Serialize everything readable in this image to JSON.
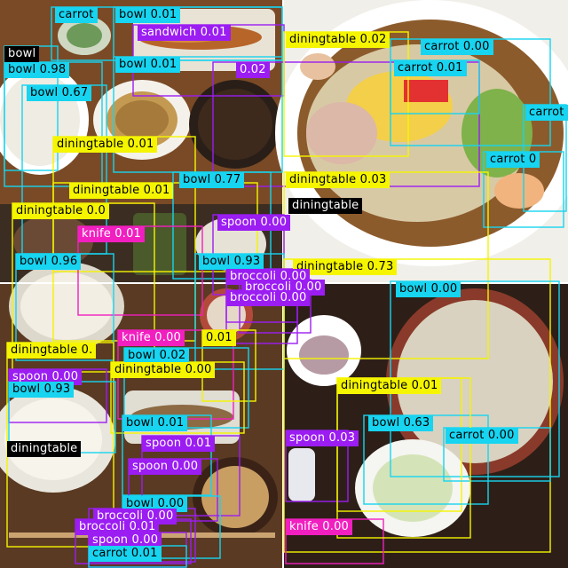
{
  "colors": {
    "bowl": "#17d4f0",
    "diningtable": "#f5f500",
    "carrot": "#17d4f0",
    "spoon": "#9b1df2",
    "knife": "#f21fc0",
    "broccoli": "#9b1df2",
    "sandwich": "#9b1df2",
    "dark_label": "#000000",
    "white_text": "#ffffff",
    "black_text": "#000000"
  },
  "photos": [
    {
      "name": "top-left-photo",
      "desc": "rice, noodles, soup, grilled fish set meal"
    },
    {
      "name": "top-right-photo",
      "desc": "cold ramen with egg, cucumber, shrimp, chicken"
    },
    {
      "name": "bottom-left-photo",
      "desc": "rice, fish, miso soup set meal"
    },
    {
      "name": "bottom-right-photo",
      "desc": "cold noodles with dipping bowl and green onion"
    }
  ],
  "detections": [
    {
      "text": "carrot",
      "cls": "carrot",
      "score": ""
    },
    {
      "text": "bowl 0.01",
      "cls": "bowl",
      "score": "0.01"
    },
    {
      "text": "sandwich 0.01",
      "cls": "sandwich",
      "score": "0.01"
    },
    {
      "text": "bowl",
      "cls": "dark",
      "score": ""
    },
    {
      "text": "bowl 0.98",
      "cls": "bowl",
      "score": "0.98"
    },
    {
      "text": "bowl 0.01",
      "cls": "bowl",
      "score": "0.01"
    },
    {
      "text": "0.02",
      "cls": "sandwich",
      "score": "0.02"
    },
    {
      "text": "bowl 0.67",
      "cls": "bowl",
      "score": "0.67"
    },
    {
      "text": "diningtable 0.01",
      "cls": "diningtable",
      "score": "0.01"
    },
    {
      "text": "diningtable 0.02",
      "cls": "diningtable",
      "score": "0.02"
    },
    {
      "text": "carrot 0.00",
      "cls": "carrot",
      "score": "0.00"
    },
    {
      "text": "carrot 0.01",
      "cls": "carrot",
      "score": "0.01"
    },
    {
      "text": "carrot",
      "cls": "carrot",
      "score": ""
    },
    {
      "text": "carrot 0",
      "cls": "carrot",
      "score": "0"
    },
    {
      "text": "diningtable 0.03",
      "cls": "diningtable",
      "score": "0.03"
    },
    {
      "text": "diningtable",
      "cls": "dark",
      "score": ""
    },
    {
      "text": "diningtable 0.01",
      "cls": "diningtable",
      "score": "0.01"
    },
    {
      "text": "bowl 0.77",
      "cls": "bowl",
      "score": "0.77"
    },
    {
      "text": "diningtable 0.0",
      "cls": "diningtable",
      "score": "0.0"
    },
    {
      "text": "knife 0.01",
      "cls": "knife",
      "score": "0.01"
    },
    {
      "text": "spoon 0.00",
      "cls": "spoon",
      "score": "0.00"
    },
    {
      "text": "bowl 0.96",
      "cls": "bowl",
      "score": "0.96"
    },
    {
      "text": "bowl 0.93",
      "cls": "bowl",
      "score": "0.93"
    },
    {
      "text": "diningtable 0.73",
      "cls": "diningtable",
      "score": "0.73"
    },
    {
      "text": "broccoli 0.00",
      "cls": "broccoli",
      "score": "0.00"
    },
    {
      "text": "broccoli 0.00",
      "cls": "broccoli",
      "score": "0.00"
    },
    {
      "text": "broccoli 0.00",
      "cls": "broccoli",
      "score": "0.00"
    },
    {
      "text": "bowl 0.00",
      "cls": "bowl",
      "score": "0.00"
    },
    {
      "text": "knife 0.00",
      "cls": "knife",
      "score": "0.00"
    },
    {
      "text": "0.01",
      "cls": "diningtable",
      "score": "0.01"
    },
    {
      "text": "diningtable 0.",
      "cls": "diningtable",
      "score": "0."
    },
    {
      "text": "bowl 0.02",
      "cls": "bowl",
      "score": "0.02"
    },
    {
      "text": "diningtable 0.00",
      "cls": "diningtable",
      "score": "0.00"
    },
    {
      "text": "spoon 0.00",
      "cls": "spoon",
      "score": "0.00"
    },
    {
      "text": "bowl 0.93",
      "cls": "bowl",
      "score": "0.93"
    },
    {
      "text": "diningtable 0.01",
      "cls": "diningtable",
      "score": "0.01"
    },
    {
      "text": "bowl 0.01",
      "cls": "bowl",
      "score": "0.01"
    },
    {
      "text": "bowl 0.63",
      "cls": "bowl",
      "score": "0.63"
    },
    {
      "text": "carrot 0.00",
      "cls": "carrot",
      "score": "0.00"
    },
    {
      "text": "spoon 0.03",
      "cls": "spoon",
      "score": "0.03"
    },
    {
      "text": "diningtable",
      "cls": "dark",
      "score": ""
    },
    {
      "text": "spoon 0.01",
      "cls": "spoon",
      "score": "0.01"
    },
    {
      "text": "spoon 0.00",
      "cls": "spoon",
      "score": "0.00"
    },
    {
      "text": "bowl 0.00",
      "cls": "bowl",
      "score": "0.00"
    },
    {
      "text": "broccoli 0.00",
      "cls": "broccoli",
      "score": "0.00"
    },
    {
      "text": "broccoli 0.01",
      "cls": "broccoli",
      "score": "0.01"
    },
    {
      "text": "spoon 0.00",
      "cls": "spoon",
      "score": "0.00"
    },
    {
      "text": "carrot 0.01",
      "cls": "carrot",
      "score": "0.01"
    },
    {
      "text": "knife 0.00",
      "cls": "knife",
      "score": "0.00"
    },
    {
      "text": "diningtable 0.01",
      "cls": "diningtable",
      "score": "0.01"
    }
  ]
}
